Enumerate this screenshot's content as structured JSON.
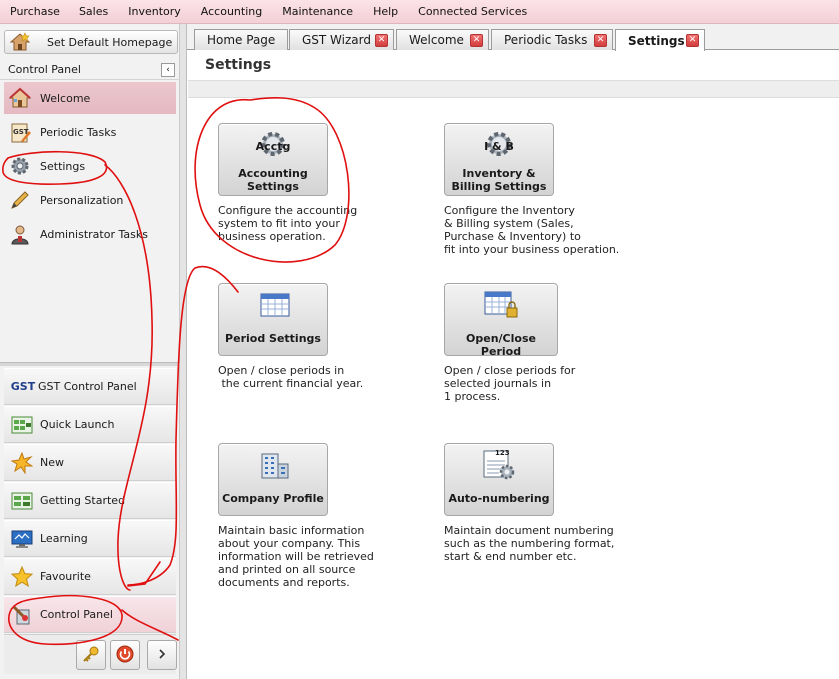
{
  "menu": [
    "Purchase",
    "Sales",
    "Inventory",
    "Accounting",
    "Maintenance",
    "Help",
    "Connected Services"
  ],
  "sidebar": {
    "set_default_homepage": "Set Default Homepage",
    "panel_title": "Control Panel",
    "collapse_glyph": "‹",
    "items": [
      {
        "label": "Welcome",
        "icon": "house-icon",
        "active": true
      },
      {
        "label": "Periodic Tasks",
        "icon": "gst-clipboard-icon"
      },
      {
        "label": "Settings",
        "icon": "gear-icon"
      },
      {
        "label": "Personalization",
        "icon": "pencil-icon"
      },
      {
        "label": "Administrator Tasks",
        "icon": "admin-user-icon"
      }
    ],
    "quick": [
      {
        "label": "GST Control Panel",
        "icon": "gst-logo-icon",
        "badge": "GST"
      },
      {
        "label": "Quick Launch",
        "icon": "quick-launch-icon"
      },
      {
        "label": "New",
        "icon": "new-star-icon"
      },
      {
        "label": "Getting Started",
        "icon": "getting-started-icon"
      },
      {
        "label": "Learning",
        "icon": "monitor-icon"
      },
      {
        "label": "Favourite",
        "icon": "star-icon"
      },
      {
        "label": "Control Panel",
        "icon": "control-panel-icon",
        "active": true
      }
    ]
  },
  "tabs": [
    {
      "label": "Home Page",
      "closable": false
    },
    {
      "label": "GST Wizard",
      "closable": true
    },
    {
      "label": "Welcome",
      "closable": true
    },
    {
      "label": "Periodic Tasks",
      "closable": true
    },
    {
      "label": "Settings",
      "closable": true,
      "active": true
    }
  ],
  "page": {
    "title": "Settings",
    "cards": [
      {
        "icon": "accounting-gear-icon",
        "icon_text": "Acctg",
        "title": "Accounting\nSettings",
        "desc": "Configure the accounting\nsystem to fit into your\nbusiness operation."
      },
      {
        "icon": "inventory-gear-icon",
        "icon_text": "I & B",
        "title": "Inventory &\nBilling Settings",
        "desc": "Configure the Inventory\n& Billing system (Sales,\nPurchase & Inventory) to\nfit into your business operation."
      },
      {
        "icon": "calendar-icon",
        "title": "Period Settings",
        "desc": "Open / close periods in\n the current financial year."
      },
      {
        "icon": "calendar-lock-icon",
        "title": "Open/Close Period",
        "desc": "Open / close periods for\nselected journals in\n1 process."
      },
      {
        "icon": "building-icon",
        "title": "Company Profile",
        "desc": "Maintain basic information\nabout your company. This\ninformation will be retrieved\nand printed on all source\ndocuments and reports."
      },
      {
        "icon": "numbering-icon",
        "icon_text": "123",
        "title": "Auto-numbering",
        "desc": "Maintain document numbering\nsuch as the numbering format,\nstart & end number etc."
      }
    ]
  },
  "colors": {
    "menubar": "#f3cfd6",
    "active_nav": "#e5b9c1",
    "annotation": "#e01010",
    "close_btn": "#d33d3d"
  }
}
